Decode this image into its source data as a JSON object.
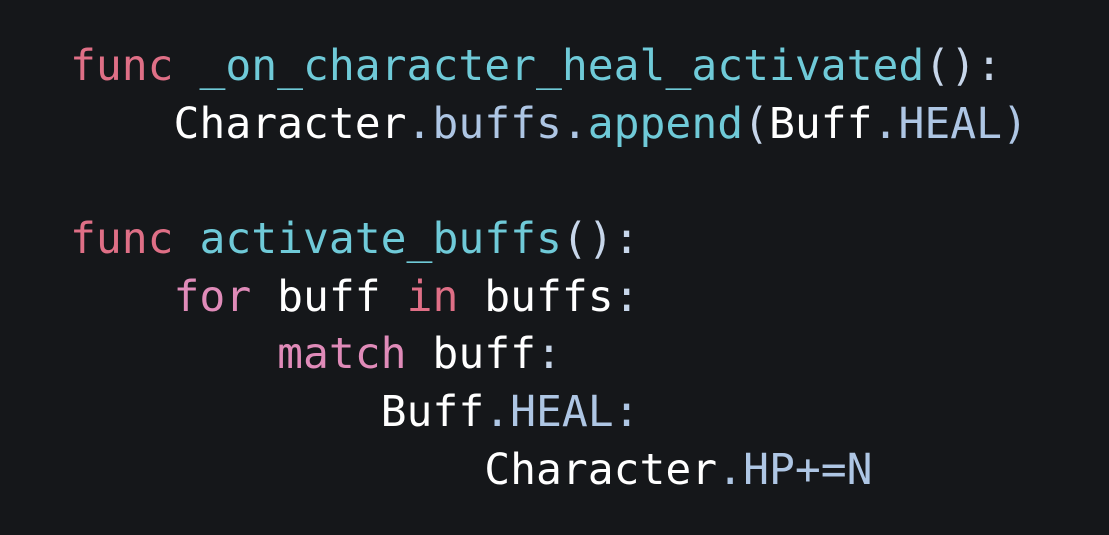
{
  "colors": {
    "background": "#15171a",
    "keyword": "#df6f86",
    "control": "#e08bb9",
    "function": "#6fcad8",
    "identifier": "#ffffff",
    "member": "#aec6e4",
    "punct": "#c7d6ea"
  },
  "lines": [
    {
      "indent": 0,
      "tokens": [
        {
          "text": "func",
          "kind": "keyword"
        },
        {
          "text": " ",
          "kind": "identifier"
        },
        {
          "text": "_on_character_heal_activated",
          "kind": "function"
        },
        {
          "text": "():",
          "kind": "punct"
        }
      ]
    },
    {
      "indent": 1,
      "tokens": [
        {
          "text": "Character",
          "kind": "identifier"
        },
        {
          "text": ".buffs.",
          "kind": "member"
        },
        {
          "text": "append",
          "kind": "function"
        },
        {
          "text": "(",
          "kind": "punct"
        },
        {
          "text": "Buff",
          "kind": "identifier"
        },
        {
          "text": ".HEAL)",
          "kind": "member"
        }
      ]
    },
    {
      "indent": 0,
      "tokens": []
    },
    {
      "indent": 0,
      "tokens": [
        {
          "text": "func",
          "kind": "keyword"
        },
        {
          "text": " ",
          "kind": "identifier"
        },
        {
          "text": "activate_buffs",
          "kind": "function"
        },
        {
          "text": "():",
          "kind": "punct"
        }
      ]
    },
    {
      "indent": 1,
      "tokens": [
        {
          "text": "for",
          "kind": "control"
        },
        {
          "text": " buff ",
          "kind": "identifier"
        },
        {
          "text": "in",
          "kind": "keyword"
        },
        {
          "text": " buffs",
          "kind": "identifier"
        },
        {
          "text": ":",
          "kind": "punct"
        }
      ]
    },
    {
      "indent": 2,
      "tokens": [
        {
          "text": "match",
          "kind": "control"
        },
        {
          "text": " buff",
          "kind": "identifier"
        },
        {
          "text": ":",
          "kind": "punct"
        }
      ]
    },
    {
      "indent": 3,
      "tokens": [
        {
          "text": "Buff",
          "kind": "identifier"
        },
        {
          "text": ".HEAL:",
          "kind": "member"
        }
      ]
    },
    {
      "indent": 4,
      "tokens": [
        {
          "text": "Character",
          "kind": "identifier"
        },
        {
          "text": ".HP+=N",
          "kind": "member"
        }
      ]
    }
  ]
}
